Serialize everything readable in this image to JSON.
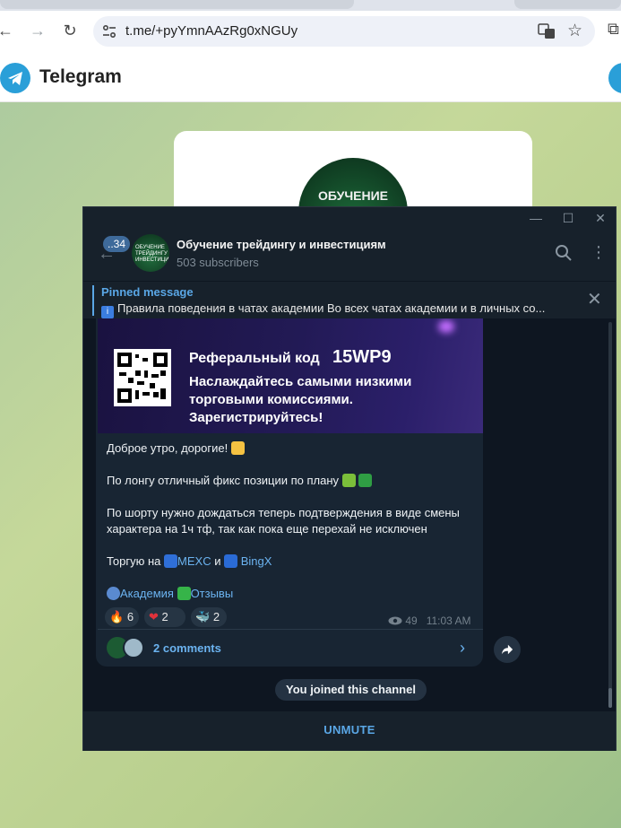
{
  "browser": {
    "url": "t.me/+pyYmnAAzRg0xNGUy"
  },
  "site": {
    "brand": "Telegram",
    "card_avatar_text": "ОБУЧЕНИЕ"
  },
  "chat": {
    "unread_badge": "..34",
    "title": "Обучение трейдингу и инвестициям",
    "subtitle": "503 subscribers",
    "avatar_text": "ОБУЧЕНИЕ ТРЕЙДИНГУ ИНВЕСТИЦИЯМ",
    "pinned": {
      "title": "Pinned message",
      "text": "Правила поведения в чатах академии  Во всех чатах академии и в личных со..."
    }
  },
  "message": {
    "banner": {
      "ref_label": "Реферальный код",
      "ref_code": "15WP9",
      "line1": "Наслаждайтесь самыми низкими",
      "line2": "торговыми комиссиями.",
      "line3": "Зарегистрируйтесь!"
    },
    "lines": {
      "greeting": "Доброе утро, дорогие!",
      "long": "По лонгу отличный фикс позиции по плану",
      "short1": "По шорту нужно дождаться теперь подтверждения в виде смены",
      "short2": "характера на 1ч тф, так как пока еще перехай не исключен",
      "trade_prefix": "Торгую на",
      "mexc": "MEXC",
      "and": "и",
      "bingx": "BingX",
      "academy": "Академия",
      "reviews": "Отзывы"
    },
    "reactions": [
      {
        "emoji": "🔥",
        "count": "6"
      },
      {
        "emoji": "❤",
        "count": "2"
      },
      {
        "emoji": "🐳",
        "count": "2"
      }
    ],
    "views": "49",
    "time": "11:03 AM",
    "comments": "2 comments"
  },
  "service": {
    "joined": "You joined this channel"
  },
  "footer": {
    "unmute": "UNMUTE"
  },
  "colors": {
    "accent": "#5aa7e6",
    "window_bg": "#0e1621",
    "panel_bg": "#17212b",
    "bubble_bg": "#182533"
  }
}
